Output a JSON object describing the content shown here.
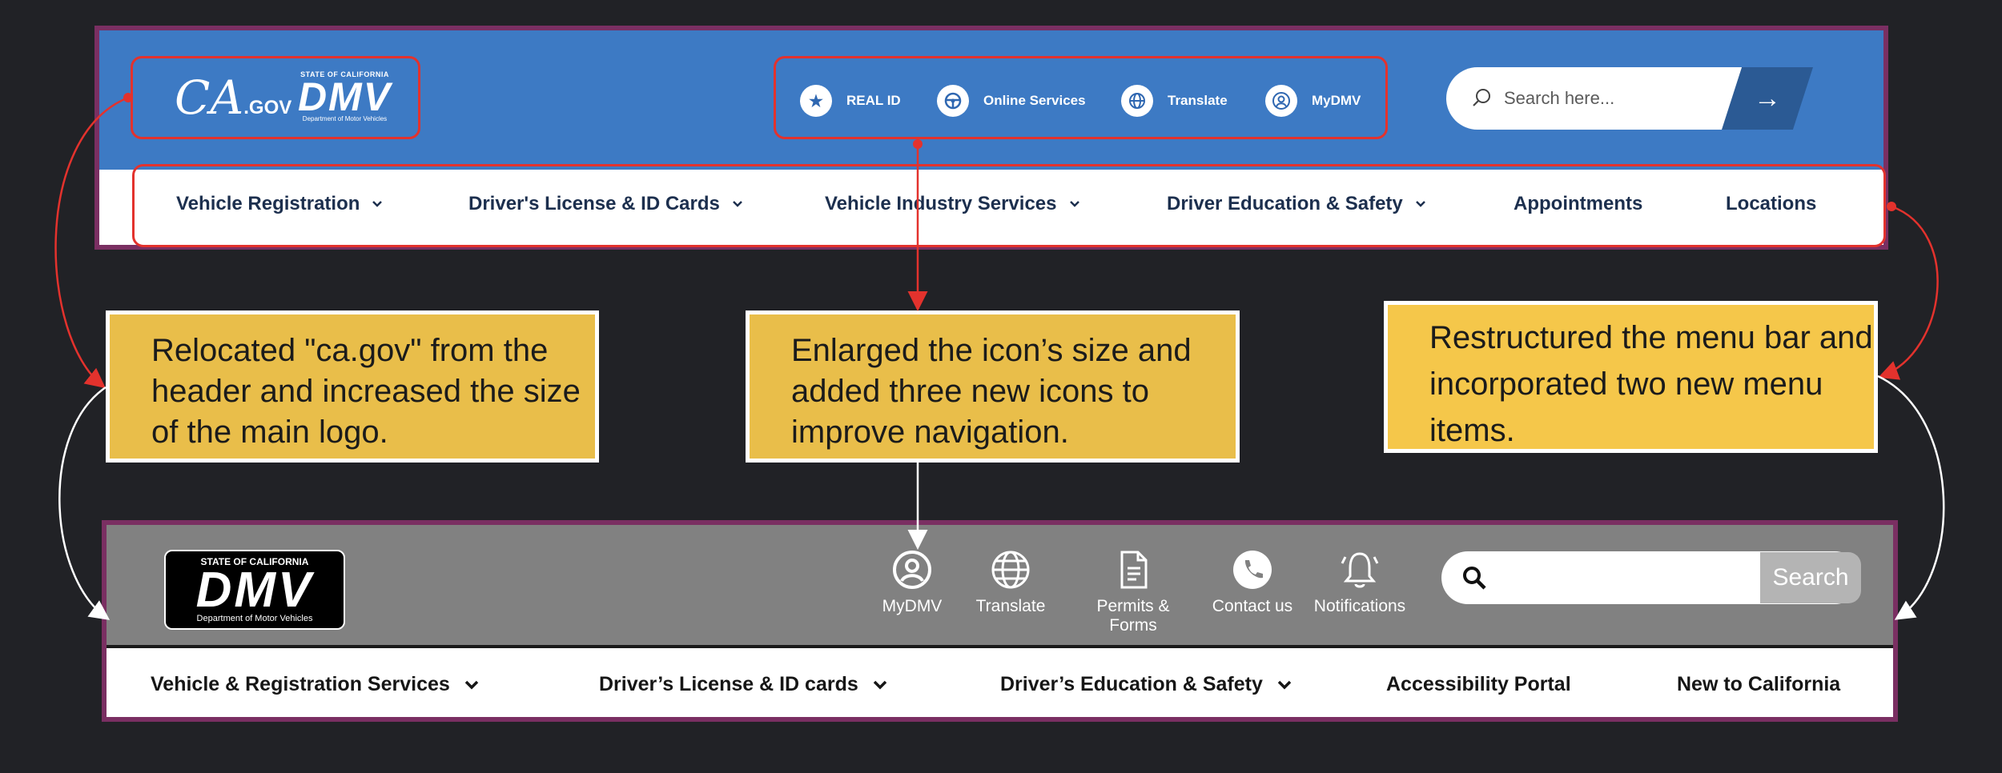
{
  "before": {
    "logos": {
      "cagov": "CA",
      "cagov_suffix": ".GOV",
      "dmv_state": "STATE OF CALIFORNIA",
      "dmv_mark": "DMV",
      "dmv_dept": "Department of Motor Vehicles"
    },
    "utility_nav": [
      {
        "label": "REAL ID",
        "icon": "star-icon"
      },
      {
        "label": "Online Services",
        "icon": "steering-wheel-icon"
      },
      {
        "label": "Translate",
        "icon": "globe-icon"
      },
      {
        "label": "MyDMV",
        "icon": "user-icon"
      }
    ],
    "search": {
      "placeholder": "Search here...",
      "button": "→"
    },
    "menu": [
      {
        "label": "Vehicle Registration",
        "dropdown": true
      },
      {
        "label": "Driver's License & ID Cards",
        "dropdown": true
      },
      {
        "label": "Vehicle Industry Services",
        "dropdown": true
      },
      {
        "label": "Driver Education & Safety",
        "dropdown": true
      },
      {
        "label": "Appointments",
        "dropdown": false
      },
      {
        "label": "Locations",
        "dropdown": false
      }
    ]
  },
  "callouts": [
    "Relocated \"ca.gov\" from the header and increased the size of the main logo.",
    "Enlarged the icon’s size and added three new icons to improve navigation.",
    "Restructured the menu bar and incorporated two new menu items."
  ],
  "after": {
    "logo": {
      "state": "STATE OF CALIFORNIA",
      "mark": "DMV",
      "dept": "Department of Motor Vehicles"
    },
    "icons": [
      {
        "label": "MyDMV",
        "icon": "user-icon"
      },
      {
        "label": "Translate",
        "icon": "globe-icon"
      },
      {
        "label": "Permits & Forms",
        "icon": "document-icon"
      },
      {
        "label": "Contact us",
        "icon": "phone-icon"
      },
      {
        "label": "Notifications",
        "icon": "bell-icon"
      }
    ],
    "search": {
      "button": "Search"
    },
    "menu": [
      {
        "label": "Vehicle & Registration Services",
        "dropdown": true
      },
      {
        "label": "Driver’s License & ID cards",
        "dropdown": true
      },
      {
        "label": "Driver’s Education & Safety",
        "dropdown": true
      },
      {
        "label": "Accessibility Portal",
        "dropdown": false
      },
      {
        "label": "New to California",
        "dropdown": false
      }
    ]
  },
  "colors": {
    "background": "#212226",
    "before_header": "#3d7ac4",
    "annotation_red": "#e3322d",
    "frame_purple": "#7a2f62",
    "callout_yellow": "#e9be4a",
    "after_header": "#818181"
  }
}
